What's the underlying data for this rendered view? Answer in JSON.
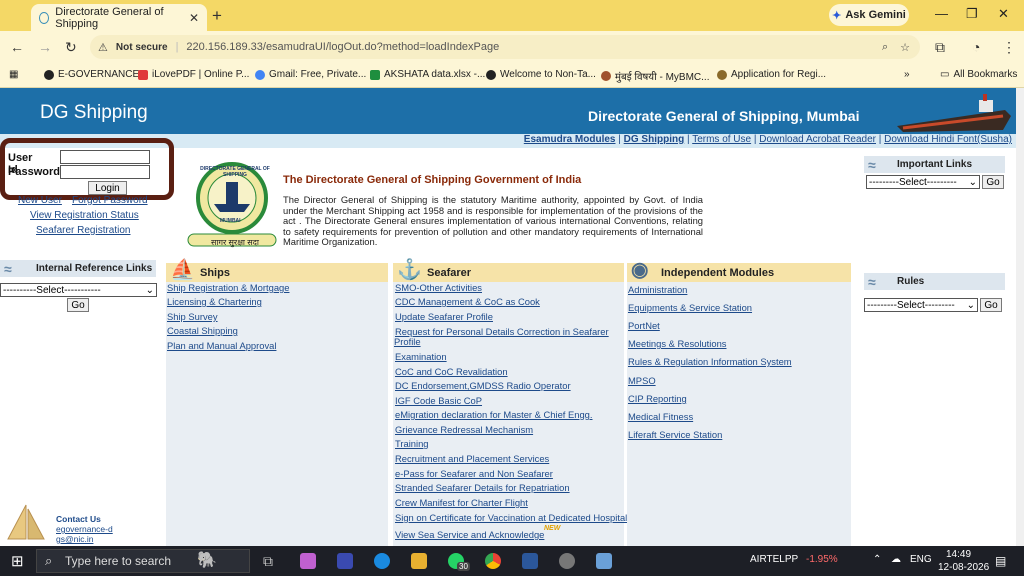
{
  "browser": {
    "tab_title": "Directorate General of Shipping",
    "new_tab": "+",
    "gemini_label": "Ask Gemini",
    "security": "Not secure",
    "url": "220.156.189.33/esamudraUI/logOut.do?method=loadIndexPage",
    "bookmarks": [
      "E-GOVERNANCE",
      "iLovePDF | Online P...",
      "Gmail: Free, Private...",
      "AKSHATA data.xlsx -...",
      "Welcome to Non-Ta...",
      "मुंबई विषयी - MyBMC...",
      "Application for Regi..."
    ],
    "all_bookmarks": "All Bookmarks"
  },
  "header": {
    "logo": "DG Shipping",
    "title": "Directorate General of Shipping, Mumbai"
  },
  "topnav": [
    "Esamudra Modules",
    "DG Shipping",
    "Terms of Use",
    "Download Acrobat Reader",
    "Download Hindi Font(Susha)"
  ],
  "login": {
    "user_label": "User Id",
    "password_label": "Password",
    "button": "Login",
    "new_user": "New User",
    "forgot": "Forgot Password",
    "view_status": "View Registration Status",
    "seafarer_reg": "Seafarer Registration"
  },
  "internal_links": {
    "title": "Internal Reference Links",
    "select": "----------Select-----------",
    "go": "Go"
  },
  "important_links": {
    "title": "Important Links",
    "select": "---------Select---------",
    "go": "Go"
  },
  "rules": {
    "title": "Rules",
    "select": "---------Select---------",
    "go": "Go"
  },
  "org": {
    "title": "The Directorate General of Shipping Government of India",
    "description": "The Director General of Shipping is the statutory Maritime authority, appointed by Govt. of India under the Merchant Shipping act 1958 and is responsible for implementation of the provisions of the act . The Directorate General ensures implementation of various international Conventions, relating to safety requirements for prevention of pollution and other mandatory requirements of International Maritime Organization.",
    "emblem_top": "DIRECTORATE GENERAL OF SHIPPING",
    "emblem_bottom": "MUMBAI",
    "motto": "सागर सुरक्षा सदा"
  },
  "ships": {
    "title": "Ships",
    "items": [
      "Ship Registration & Mortgage",
      "Licensing & Chartering",
      "Ship Survey",
      "Coastal Shipping",
      "Plan and Manual Approval"
    ]
  },
  "seafarer": {
    "title": "Seafarer",
    "items": [
      "SMO-Other Activities",
      "CDC Management & CoC as Cook",
      "Update Seafarer Profile",
      "Request for Personal Details Correction in Seafarer",
      "Profile",
      "Examination",
      "CoC and CoC Revalidation",
      "DC Endorsement,GMDSS Radio Operator",
      "IGF Code Basic CoP",
      "eMigration declaration for Master & Chief Engg.",
      "Grievance Redressal Mechanism",
      "Training",
      "Recruitment and Placement Services",
      "e-Pass for Seafarer and Non Seafarer",
      "Stranded Seafarer Details for Repatriation",
      "Crew Manifest for Charter Flight",
      "Sign on Certificate for Vaccination at Dedicated Hospital",
      "View Sea Service and Acknowledge"
    ],
    "new_badge": "NEW"
  },
  "independent": {
    "title": "Independent Modules",
    "items": [
      "Administration",
      "Equipments & Service Station",
      "PortNet",
      "Meetings & Resolutions",
      "Rules & Regulation Information System",
      "MPSO",
      "CIP Reporting",
      "Medical Fitness",
      "Liferaft Service Station"
    ]
  },
  "contact": {
    "title": "Contact Us",
    "email": "egovernance-dgs@nic.in"
  },
  "taskbar": {
    "search": "Type here to search",
    "badge": "30",
    "stock": "AIRTELPP",
    "stock_change": "-1.95%",
    "lang": "ENG",
    "time": "14:49",
    "date": "12-08-2026"
  },
  "colors": {
    "header_blue": "#1d6fa8",
    "section_tan": "#f6e3a8",
    "link_blue": "#1d4a8a",
    "title_brown": "#8a2a0a",
    "annotation_red": "#5a1f12"
  }
}
